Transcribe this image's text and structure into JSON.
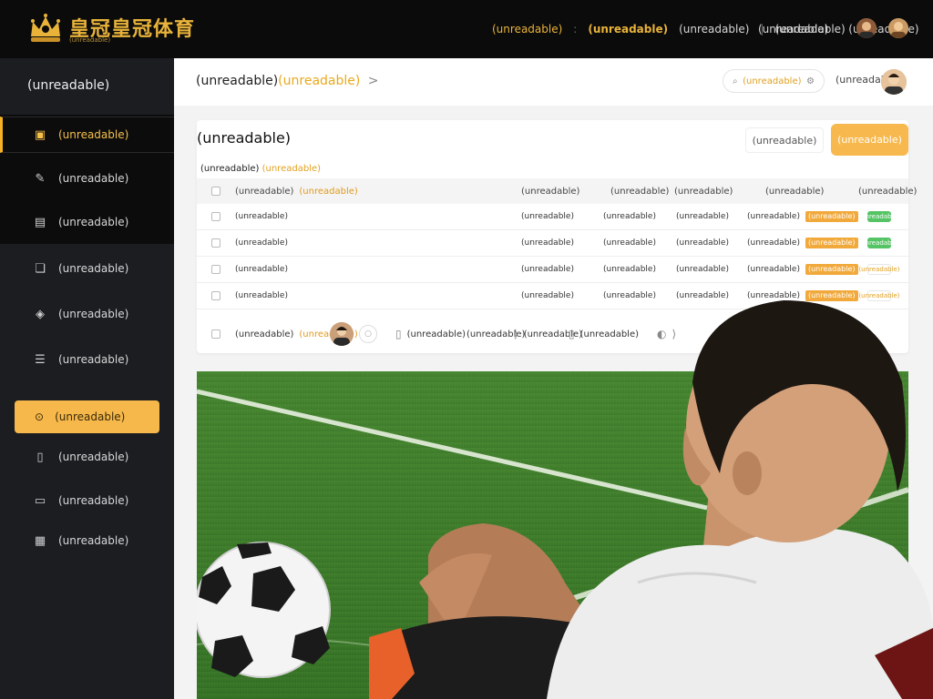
{
  "brand": {
    "title": "皇冠皇冠体育",
    "subtitle": "(unreadable)"
  },
  "topnav": {
    "item1": "(unreadable)",
    "item2": "(unreadable)",
    "item3": "(unreadable)",
    "item4": "(unreadable)",
    "right1": "(unreadable)",
    "right2": "(unreadable)"
  },
  "sidebar": {
    "header": "(unreadable)",
    "items": [
      {
        "label": "(unreadable)",
        "icon": "briefcase-icon"
      },
      {
        "label": "(unreadable)",
        "icon": "pen-icon"
      },
      {
        "label": "(unreadable)",
        "icon": "doc-icon"
      },
      {
        "label": "(unreadable)",
        "icon": "chat-icon"
      },
      {
        "label": "(unreadable)",
        "icon": "layers-icon"
      },
      {
        "label": "(unreadable)",
        "icon": "menu-icon"
      },
      {
        "label": "(unreadable)",
        "icon": "toggle-icon"
      },
      {
        "label": "(unreadable)",
        "icon": "frame-icon"
      },
      {
        "label": "(unreadable)",
        "icon": "box-icon"
      },
      {
        "label": "(unreadable)",
        "icon": "grid-icon"
      }
    ]
  },
  "breadcrumb": {
    "text": "(unreadable)",
    "accent": "(unreadable)",
    "chevron": ">",
    "pill_label": "(unreadable)",
    "user_label": "(unreadable)"
  },
  "card": {
    "title": "(unreadable)",
    "btn_secondary": "(unreadable)",
    "btn_primary": "(unreadable)",
    "description": "(unreadable)",
    "description_link": "(unreadable)",
    "columns": {
      "name_a": "(unreadable)",
      "name_b": "(unreadable)",
      "c2": "(unreadable)",
      "c3": "(unreadable)",
      "c4": "(unreadable)",
      "c5": "(unreadable)",
      "c6": "(unreadable)"
    },
    "rows": [
      {
        "name": "(unreadable)",
        "c2": "(unreadable)",
        "c3": "(unreadable)",
        "c4": "(unreadable)",
        "c5": "(unreadable)",
        "tag": "(unreadable)",
        "status": "(unreadable)",
        "status_on": true
      },
      {
        "name": "(unreadable)",
        "c2": "(unreadable)",
        "c3": "(unreadable)",
        "c4": "(unreadable)",
        "c5": "(unreadable)",
        "tag": "(unreadable)",
        "status": "(unreadable)",
        "status_on": true
      },
      {
        "name": "(unreadable)",
        "c2": "(unreadable)",
        "c3": "(unreadable)",
        "c4": "(unreadable)",
        "c5": "(unreadable)",
        "tag": "(unreadable)",
        "status": "(unreadable)",
        "status_on": false
      },
      {
        "name": "(unreadable)",
        "c2": "(unreadable)",
        "c3": "(unreadable)",
        "c4": "(unreadable)",
        "c5": "(unreadable)",
        "tag": "(unreadable)",
        "status": "(unreadable)",
        "status_on": false
      }
    ],
    "footer": {
      "label_a": "(unreadable)",
      "label_b": "(unreadable)",
      "item1": "(unreadable)",
      "item2": "(unreadable)",
      "item3": "(unreadable)",
      "item4": "(unreadable)"
    }
  },
  "colors": {
    "accent": "#f5b324",
    "sidebar_bg": "#1b1d21",
    "topbar_bg": "#0b0b0b",
    "grass": "#3f7a2a"
  }
}
